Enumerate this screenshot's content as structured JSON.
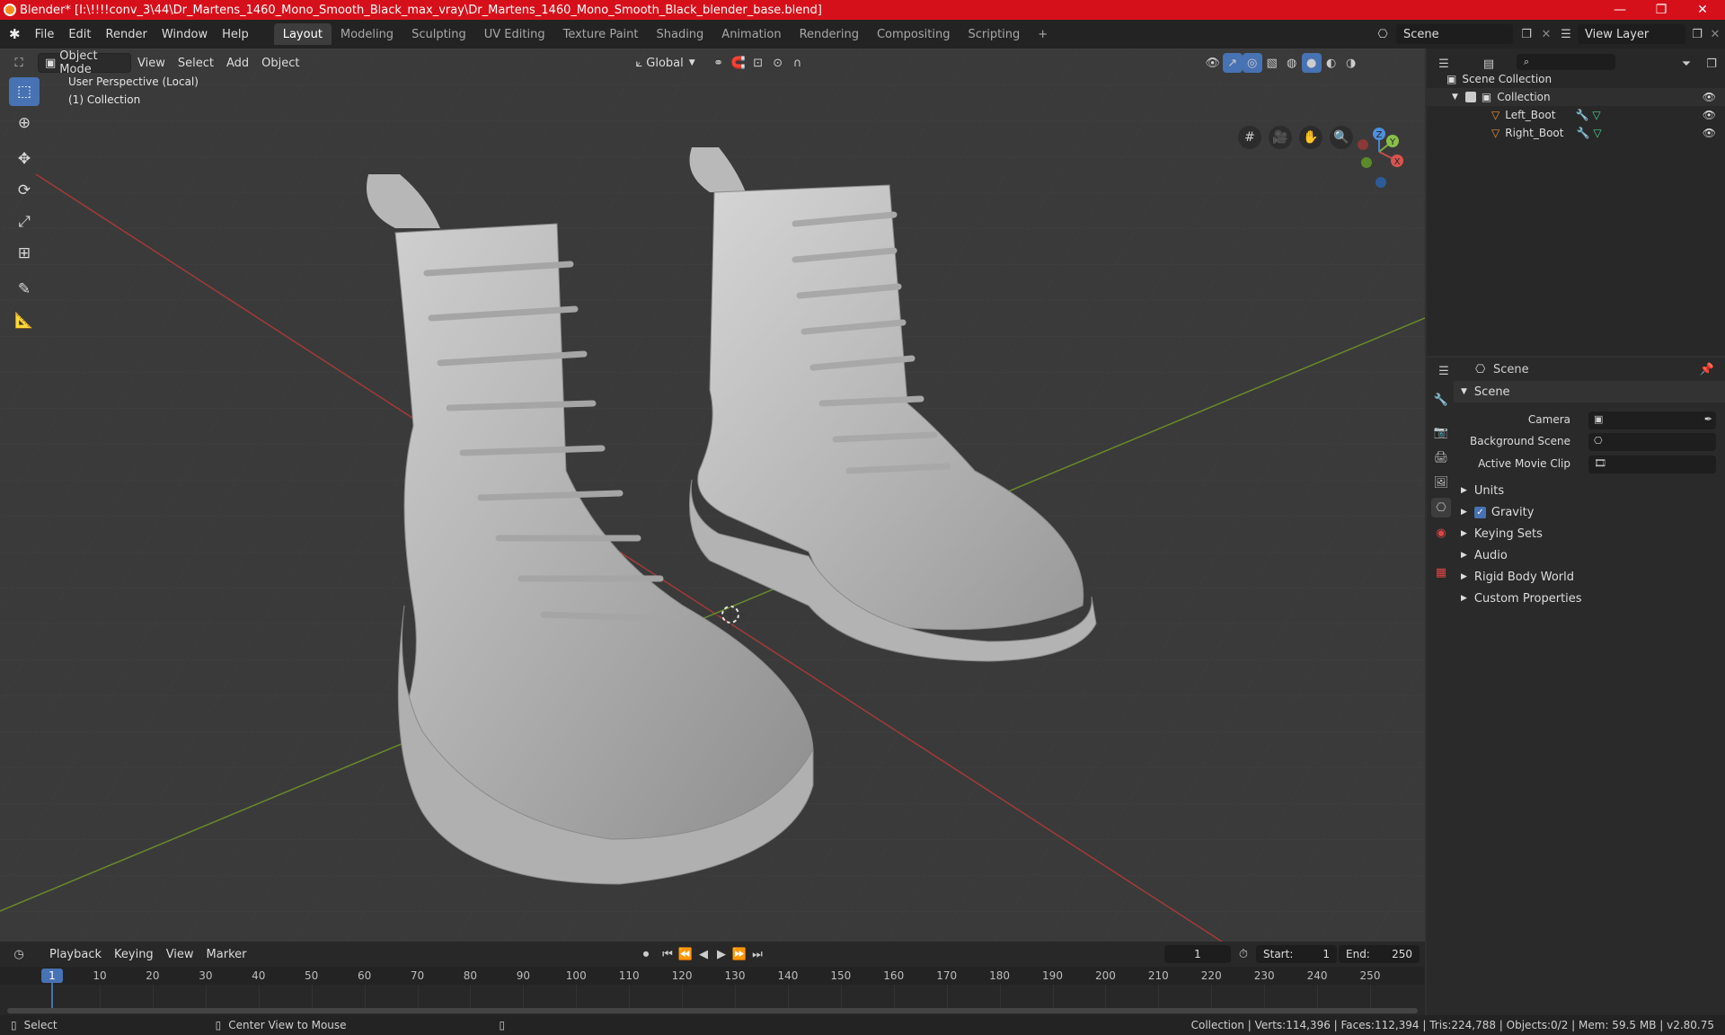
{
  "titlebar": {
    "title": "Blender* [I:\\!!!!conv_3\\44\\Dr_Martens_1460_Mono_Smooth_Black_max_vray\\Dr_Martens_1460_Mono_Smooth_Black_blender_base.blend]",
    "minimize": "—",
    "maximize": "❐",
    "close": "✕"
  },
  "menubar": {
    "menus": [
      "File",
      "Edit",
      "Render",
      "Window",
      "Help"
    ],
    "workspaces": [
      "Layout",
      "Modeling",
      "Sculpting",
      "UV Editing",
      "Texture Paint",
      "Shading",
      "Animation",
      "Rendering",
      "Compositing",
      "Scripting"
    ],
    "add_workspace": "+",
    "scene_name": "Scene",
    "view_layer_name": "View Layer"
  },
  "viewport": {
    "mode": "Object Mode",
    "menus": [
      "View",
      "Select",
      "Add",
      "Object"
    ],
    "transform_orientation": "Global",
    "perspective_label": "User Perspective (Local)",
    "collection_label": "(1) Collection",
    "axis_labels": {
      "x": "X",
      "y": "Y",
      "z": "Z"
    }
  },
  "outliner": {
    "search_placeholder": "",
    "items": [
      {
        "label": "Scene Collection"
      },
      {
        "label": "Collection"
      },
      {
        "label": "Left_Boot"
      },
      {
        "label": "Right_Boot"
      }
    ]
  },
  "properties": {
    "header": "Scene",
    "panel_title": "Scene",
    "camera_label": "Camera",
    "background_scene_label": "Background Scene",
    "active_movie_clip_label": "Active Movie Clip",
    "sections": [
      "Units",
      "Gravity",
      "Keying Sets",
      "Audio",
      "Rigid Body World",
      "Custom Properties"
    ]
  },
  "timeline": {
    "menus": [
      "Playback",
      "Keying",
      "View",
      "Marker"
    ],
    "current_frame": "1",
    "start_label": "Start:",
    "start_value": "1",
    "end_label": "End:",
    "end_value": "250",
    "ticks": [
      "1",
      "10",
      "20",
      "30",
      "40",
      "50",
      "60",
      "70",
      "80",
      "90",
      "100",
      "110",
      "120",
      "130",
      "140",
      "150",
      "160",
      "170",
      "180",
      "190",
      "200",
      "210",
      "220",
      "230",
      "240",
      "250"
    ]
  },
  "statusbar": {
    "select": "Select",
    "center_view": "Center View to Mouse",
    "stats": "Collection | Verts:114,396 | Faces:112,394 | Tris:224,788 | Objects:0/2 | Mem: 59.5 MB | v2.80.75"
  }
}
